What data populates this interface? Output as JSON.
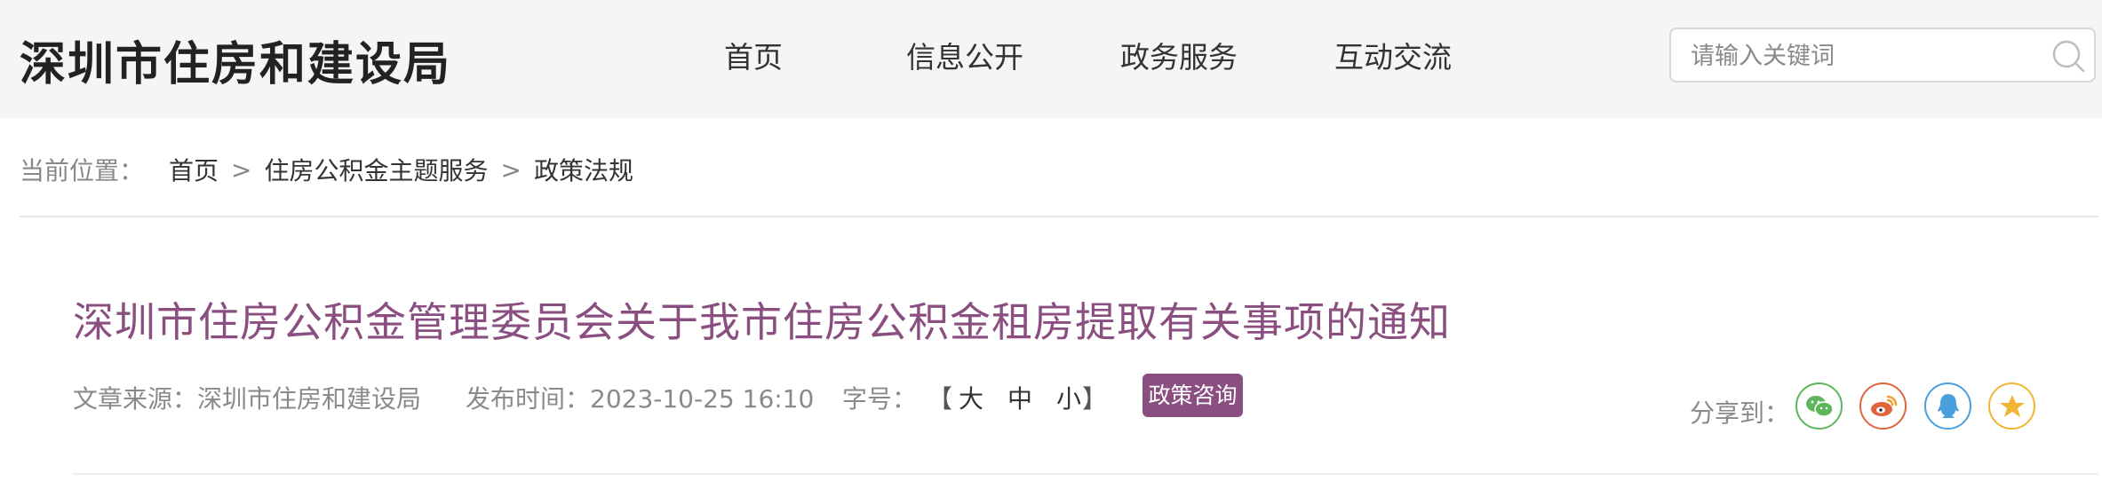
{
  "header": {
    "site_title": "深圳市住房和建设局",
    "nav": [
      {
        "label": "首页"
      },
      {
        "label": "信息公开"
      },
      {
        "label": "政务服务"
      },
      {
        "label": "互动交流"
      }
    ],
    "search": {
      "placeholder": "请输入关键词",
      "icon": "search-icon"
    }
  },
  "breadcrumb": {
    "prefix": "当前位置：",
    "items": [
      "首页",
      "住房公积金主题服务",
      "政策法规"
    ],
    "separator": ">"
  },
  "article": {
    "title": "深圳市住房公积金管理委员会关于我市住房公积金租房提取有关事项的通知",
    "source_label": "文章来源：深圳市住房和建设局",
    "publish_label": "发布时间：2023-10-25 16:10",
    "font_size_label": "字号：",
    "font_bracket_open": "【",
    "font_sizes": [
      "大",
      "中",
      "小"
    ],
    "font_bracket_close": "】",
    "consult_label": "政策咨询"
  },
  "share": {
    "label": "分享到：",
    "buttons": [
      {
        "name": "wechat",
        "icon": "wechat-icon",
        "color": "#5fb55b"
      },
      {
        "name": "weibo",
        "icon": "weibo-icon",
        "color": "#e0643c"
      },
      {
        "name": "qq",
        "icon": "qq-icon",
        "color": "#4a9fdd"
      },
      {
        "name": "qzone",
        "icon": "star-icon",
        "color": "#f0b532"
      }
    ]
  },
  "colors": {
    "title": "#8a4f80",
    "badge": "#8a4f80",
    "header_bg": "#f5f5f5"
  }
}
